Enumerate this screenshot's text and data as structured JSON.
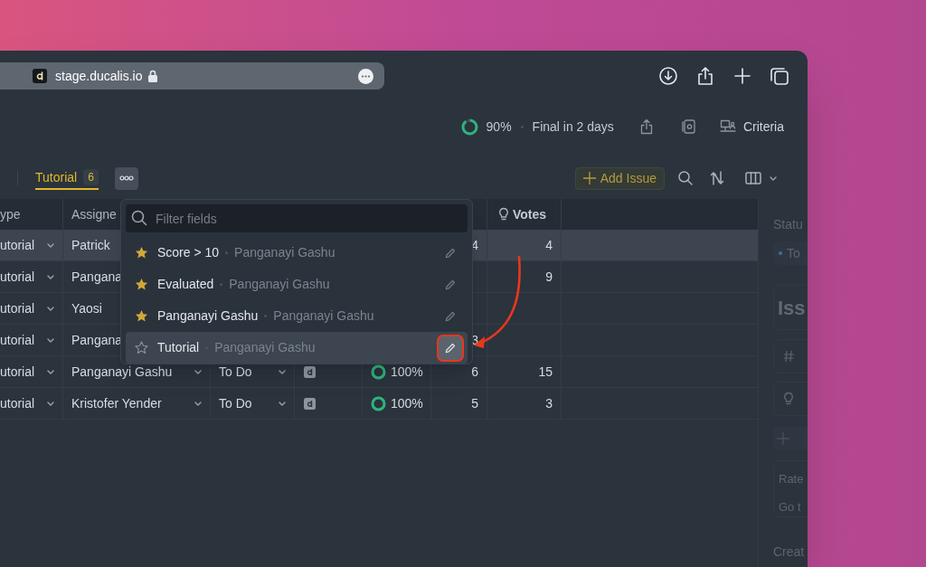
{
  "browser": {
    "url": "stage.ducalis.io"
  },
  "header": {
    "progress": {
      "level": 0.9
    },
    "percent": "90%",
    "deadline": "Final in 2 days",
    "criteria": "Criteria"
  },
  "toolbar": {
    "tabs": [
      {
        "label": "Tutorial",
        "count": "6",
        "selected": true
      }
    ],
    "add_button": "Add Issue"
  },
  "table": {
    "columns": [
      {
        "label": "ype"
      },
      {
        "label": "Assigne"
      },
      {
        "label": "Votes"
      }
    ],
    "rows": [
      {
        "type": "utorial",
        "assignee": "Patrick",
        "score": "4",
        "votes": "4",
        "selected": true
      },
      {
        "type": "utorial",
        "assignee": "Pangana",
        "votes": "9",
        "selected": false
      },
      {
        "type": "utorial",
        "assignee": "Yaosi",
        "selected": false
      },
      {
        "type": "utorial",
        "assignee": "Pangana",
        "score": "3",
        "selected": false
      },
      {
        "type": "utorial",
        "assignee": "Panganayi Gashu",
        "status": "To Do",
        "progress": {
          "level": 1,
          "text": "100%"
        },
        "score": "6",
        "votes": "15",
        "selected": false
      },
      {
        "type": "utorial",
        "assignee": "Kristofer Yender",
        "status": "To Do",
        "progress": {
          "level": 1,
          "text": "100%"
        },
        "score": "5",
        "votes": "3",
        "selected": false
      }
    ]
  },
  "dropdown": {
    "placeholder": "Filter fields",
    "items": [
      {
        "name": "Score > 10",
        "owner": "Panganayi Gashu",
        "starred": true,
        "selected": false
      },
      {
        "name": "Evaluated",
        "owner": "Panganayi Gashu",
        "starred": true,
        "selected": false
      },
      {
        "name": "Panganayi Gashu",
        "owner": "Panganayi Gashu",
        "starred": true,
        "selected": false
      },
      {
        "name": "Tutorial",
        "owner": "Panganayi Gashu",
        "starred": false,
        "selected": true
      }
    ]
  },
  "side_panel": {
    "label": "Statu",
    "status": "To",
    "title": "Iss",
    "rate": "Rate",
    "go": "Go t",
    "created": "Creat"
  }
}
